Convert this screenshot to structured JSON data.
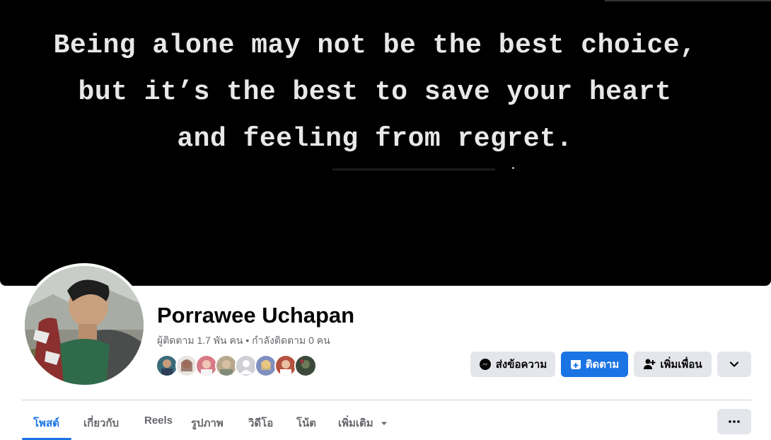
{
  "cover": {
    "quote_lines": [
      "Being alone may not be the best choice,",
      "but it’s the best to save your heart",
      "and feeling from regret."
    ]
  },
  "profile": {
    "name": "Porrawee Uchapan",
    "followers_text": "ผู้ติดตาม 1.7 พัน คน",
    "separator": " • ",
    "following_text": "กำลังติดตาม 0 คน"
  },
  "friends": [
    {
      "icon": "friend-avatar-1",
      "color": "#3a6b7a"
    },
    {
      "icon": "friend-avatar-2",
      "color": "#c98f8a"
    },
    {
      "icon": "friend-avatar-3",
      "color": "#d77b86"
    },
    {
      "icon": "friend-avatar-4",
      "color": "#b8a98e"
    },
    {
      "icon": "friend-avatar-5",
      "color": "#ced0d4"
    },
    {
      "icon": "friend-avatar-6",
      "color": "#7f8fbf"
    },
    {
      "icon": "friend-avatar-7",
      "color": "#b5523f"
    },
    {
      "icon": "friend-avatar-8",
      "color": "#3b4a3a"
    }
  ],
  "actions": {
    "message_label": "ส่งข้อความ",
    "follow_label": "ติดตาม",
    "add_friend_label": "เพิ่มเพื่อน"
  },
  "tabs": {
    "posts": "โพสต์",
    "about": "เกี่ยวกับ",
    "reels": "Reels",
    "photos": "รูปภาพ",
    "videos": "วิดีโอ",
    "notes": "โน้ต",
    "more": "เพิ่มเติม"
  },
  "colors": {
    "accent": "#1b74e4",
    "button_grey": "#e4e6eb",
    "text_secondary": "#65676b"
  }
}
